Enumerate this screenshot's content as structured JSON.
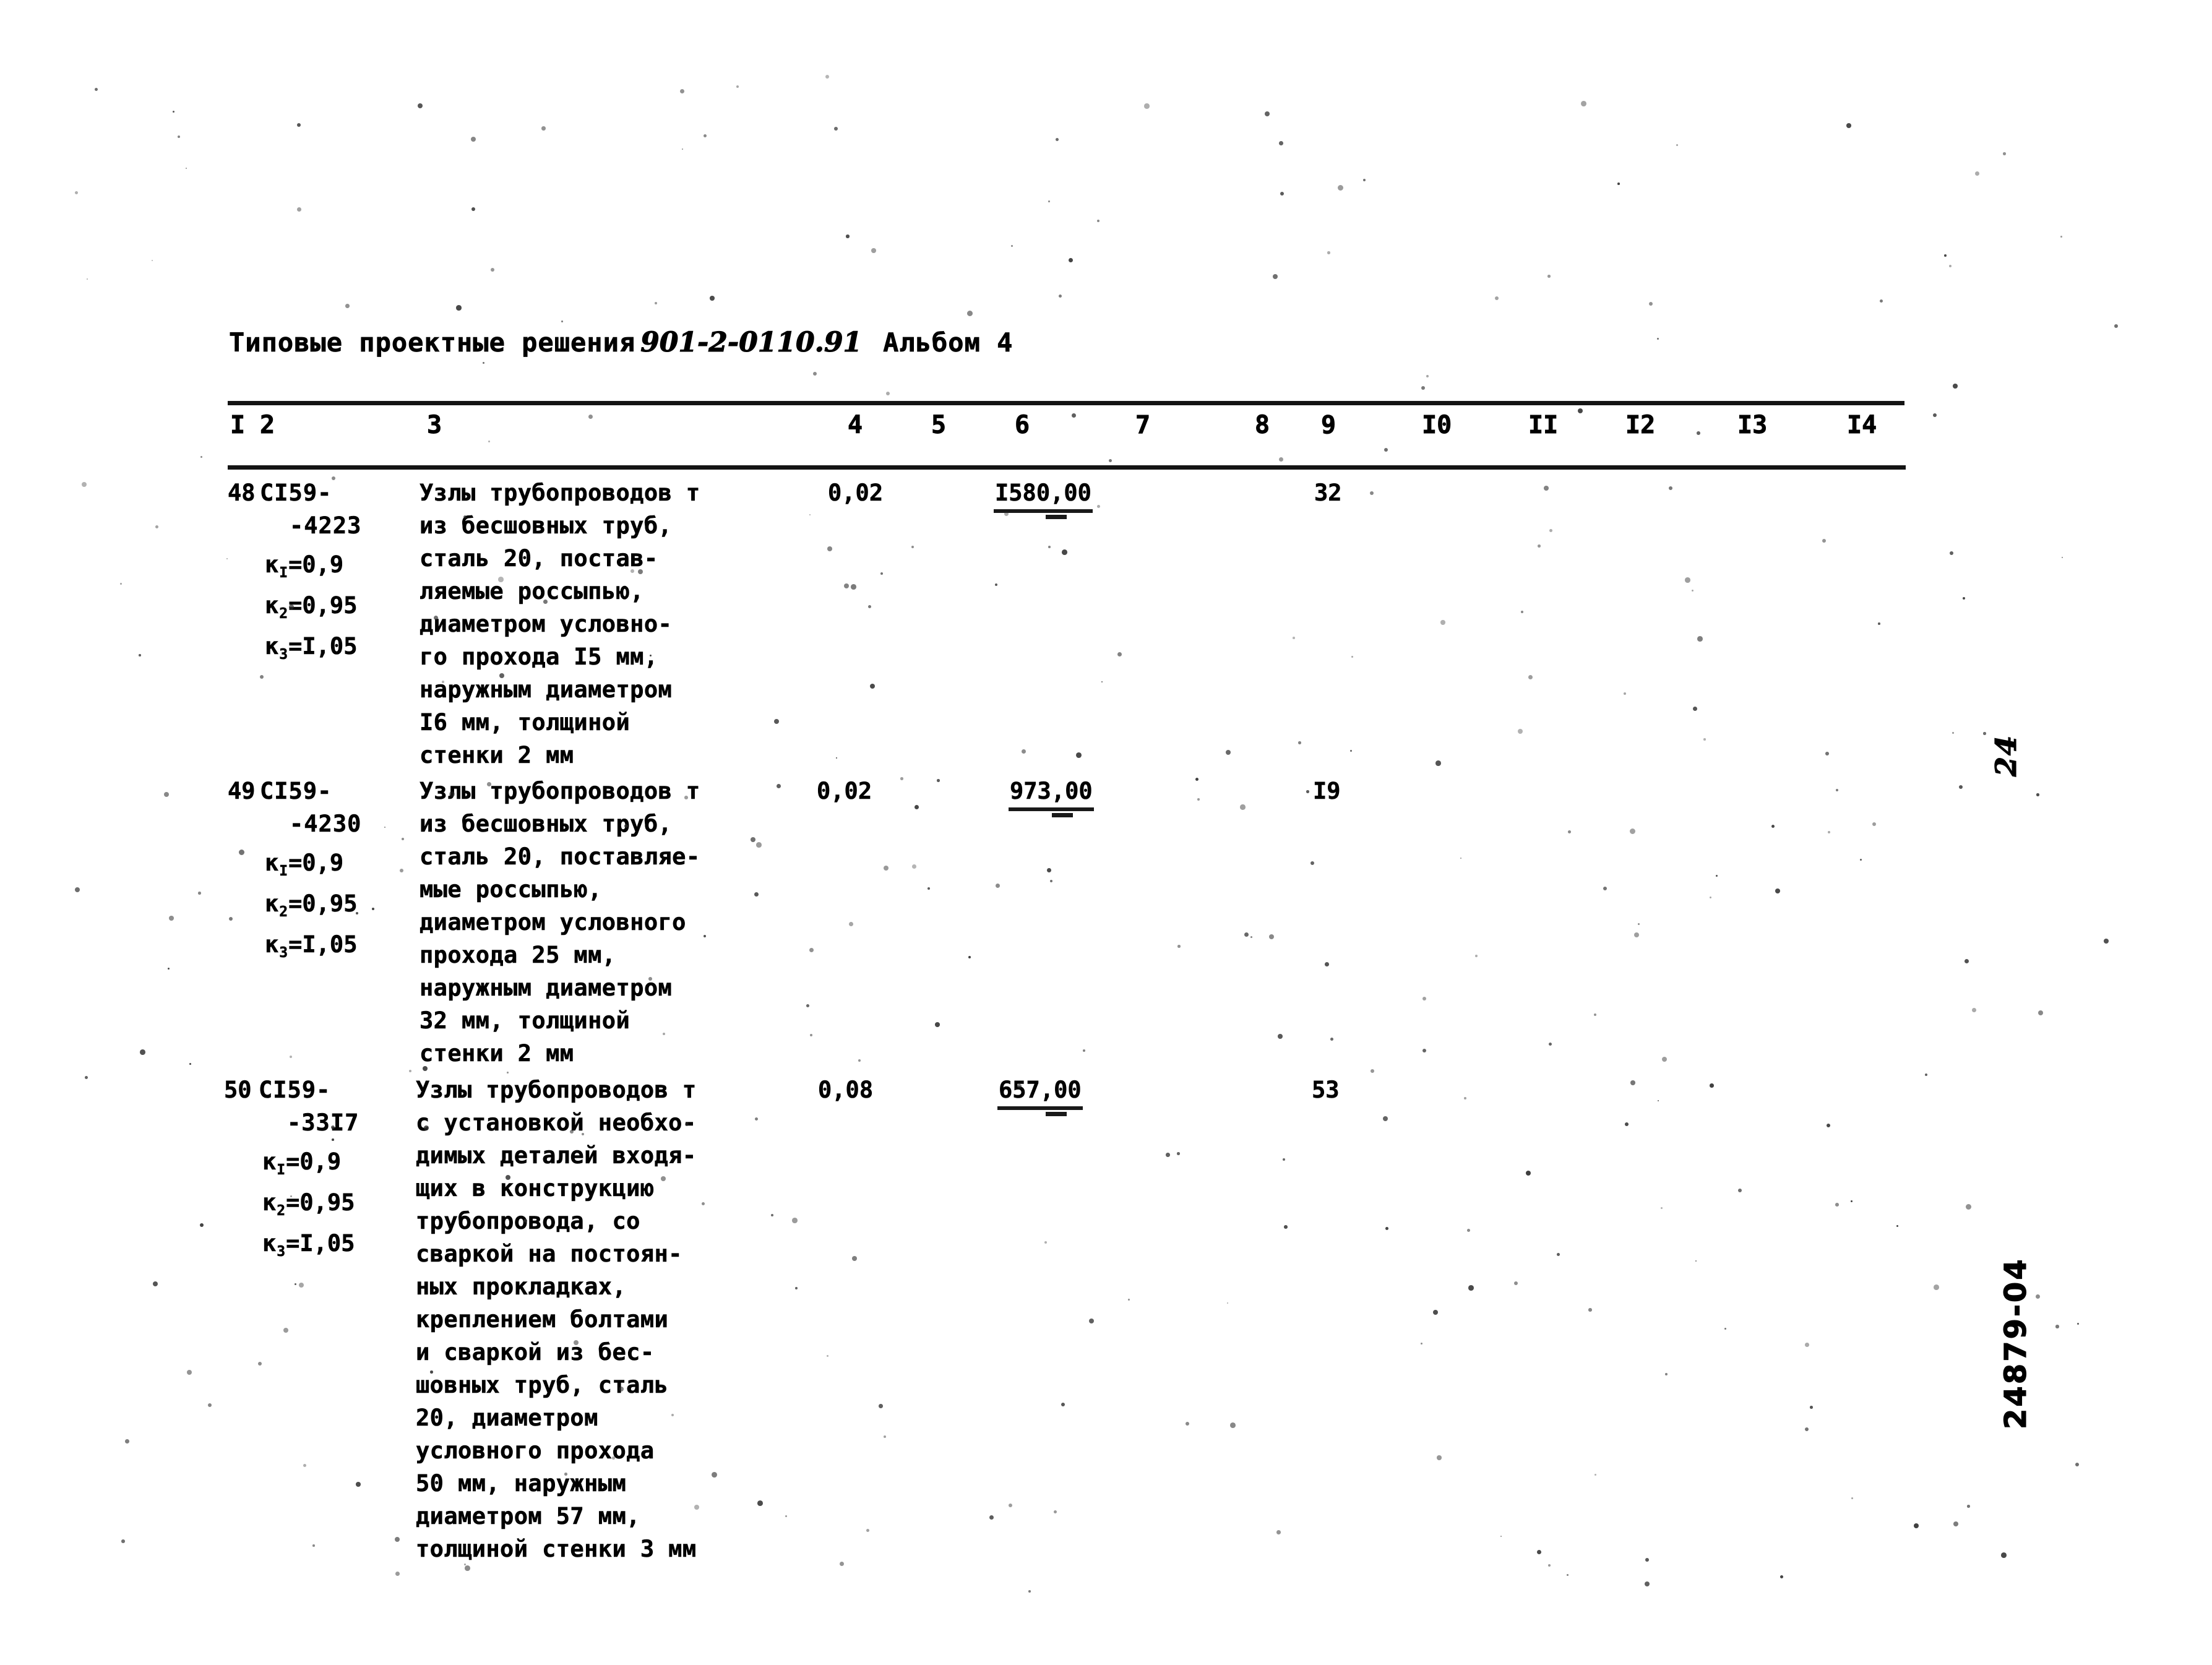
{
  "document": {
    "header_prefix": "Типовые проектные решения",
    "header_code": "901-2-0110.91",
    "header_album": "Альбом 4",
    "page_mark": "24",
    "archive_code": "24879-04"
  },
  "table": {
    "column_headers": [
      "I",
      "2",
      "3",
      "4",
      "5",
      "6",
      "7",
      "8",
      "9",
      "I0",
      "II",
      "I2",
      "I3",
      "I4"
    ],
    "rows": [
      {
        "no": "48",
        "code_line1": "СI59-",
        "code_line2": "-4223",
        "coef1_label": "к",
        "coef1_sub": "I",
        "coef1_value": "=0,9",
        "coef2_label": "к",
        "coef2_sub": "2",
        "coef2_value": "=0,95",
        "coef3_label": "к",
        "coef3_sub": "3",
        "coef3_value": "=I,05",
        "description": "Узлы трубопроводов т\nиз бесшовных труб,\nсталь 20, постав-\nляемые россыпью,\nдиаметром условно-\nго прохода I5 мм,\nнаружным диаметром\nI6 мм, толщиной\nстенки 2 мм",
        "col4": "0,02",
        "col6": "I580,00",
        "col9": "32"
      },
      {
        "no": "49",
        "code_line1": "СI59-",
        "code_line2": "-4230",
        "coef1_label": "к",
        "coef1_sub": "I",
        "coef1_value": "=0,9",
        "coef2_label": "к",
        "coef2_sub": "2",
        "coef2_value": "=0,95",
        "coef3_label": "к",
        "coef3_sub": "3",
        "coef3_value": "=I,05",
        "description": "Узлы трубопроводов т\nиз бесшовных труб,\nсталь 20, поставляе-\nмые россыпью,\nдиаметром условного\nпрохода 25 мм,\nнаружным диаметром\n32 мм, толщиной\nстенки 2 мм",
        "col4": "0,02",
        "col6": "973,00",
        "col9": "I9"
      },
      {
        "no": "50",
        "code_line1": "СI59-",
        "code_line2": "-33I7",
        "coef1_label": "к",
        "coef1_sub": "I",
        "coef1_value": "=0,9",
        "coef2_label": "к",
        "coef2_sub": "2",
        "coef2_value": "=0,95",
        "coef3_label": "к",
        "coef3_sub": "3",
        "coef3_value": "=I,05",
        "description": "Узлы трубопроводов т\nс установкой необхо-\nдимых деталей входя-\nщих в конструкцию\nтрубопровода, со\nсваркой на постоян-\nных прокладках,\nкреплением болтами\nи сваркой из бес-\nшовных труб, сталь\n20, диаметром\nусловного прохода\n50 мм, наружным\nдиаметром 57 мм,\nтолщиной стенки 3 мм",
        "col4": "0,08",
        "col6": "657,00",
        "col9": "53"
      }
    ]
  }
}
